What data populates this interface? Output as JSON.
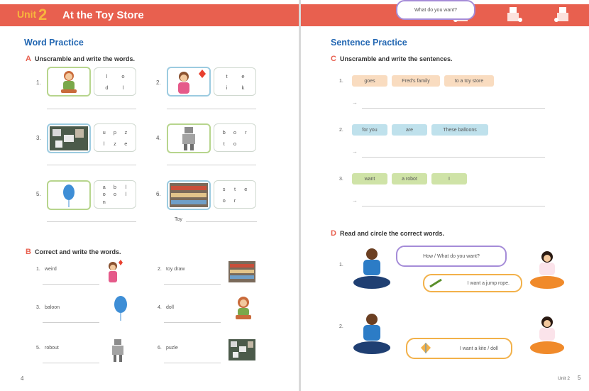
{
  "header_left": {
    "unit_label": "Unit",
    "unit_number": "2",
    "title": "At the Toy Store"
  },
  "left": {
    "section_title": "Word Practice",
    "instruction_a": {
      "letter": "A",
      "text": "Unscramble and write the words."
    },
    "items_a": [
      {
        "num": "1.",
        "letters": [
          "l",
          "o",
          "d",
          "l"
        ],
        "pic": "doll-icon"
      },
      {
        "num": "2.",
        "letters": [
          "t",
          "e",
          "i",
          "k"
        ],
        "pic": "girl-kite-icon"
      },
      {
        "num": "3.",
        "letters": [
          "u",
          "p",
          "z",
          "l",
          "z",
          "e"
        ],
        "pic": "puzzle-icon"
      },
      {
        "num": "4.",
        "letters": [
          "b",
          "o",
          "r",
          "t",
          "o"
        ],
        "pic": "robot-icon"
      },
      {
        "num": "5.",
        "letters": [
          "a",
          "b",
          "l",
          "o",
          "o",
          "l",
          "n"
        ],
        "pic": "balloon-icon"
      },
      {
        "num": "6.",
        "letters": [
          "s",
          "t",
          "e",
          "o",
          "r"
        ],
        "pic": "store-icon",
        "prefix": "Toy"
      }
    ],
    "instruction_b": {
      "letter": "B",
      "text": "Correct and write the words."
    },
    "items_b": [
      {
        "num": "1.",
        "word": "weird"
      },
      {
        "num": "2.",
        "word": "toy draw"
      },
      {
        "num": "3.",
        "word": "baloon"
      },
      {
        "num": "4.",
        "word": "doll"
      },
      {
        "num": "5.",
        "word": "robout"
      },
      {
        "num": "6.",
        "word": "puzle"
      }
    ],
    "page_number": "4"
  },
  "right": {
    "section_title": "Sentence Practice",
    "instruction_c": {
      "letter": "C",
      "text": "Unscramble and write the sentences."
    },
    "items_c": [
      {
        "num": "1.",
        "chips": [
          "goes",
          "Fred's family",
          "to a toy store"
        ]
      },
      {
        "num": "2.",
        "chips": [
          "for you",
          "are",
          "These balloons"
        ]
      },
      {
        "num": "3.",
        "chips": [
          "want",
          "a robot",
          "I"
        ]
      }
    ],
    "answer_arrow": "→",
    "instruction_d": {
      "letter": "D",
      "text": "Read and circle the correct words."
    },
    "items_d": [
      {
        "num": "1.",
        "question": "How / What  do you want?",
        "answer": "I want a jump rope."
      },
      {
        "num": "2.",
        "question": "What do you want?",
        "answer": "I want a  kite  /  doll"
      }
    ],
    "footer_unit": "Unit 2",
    "page_number": "5"
  },
  "colors": {
    "header": "#e8604f",
    "title_blue": "#2468b3",
    "accent_orange": "#e8604f"
  }
}
